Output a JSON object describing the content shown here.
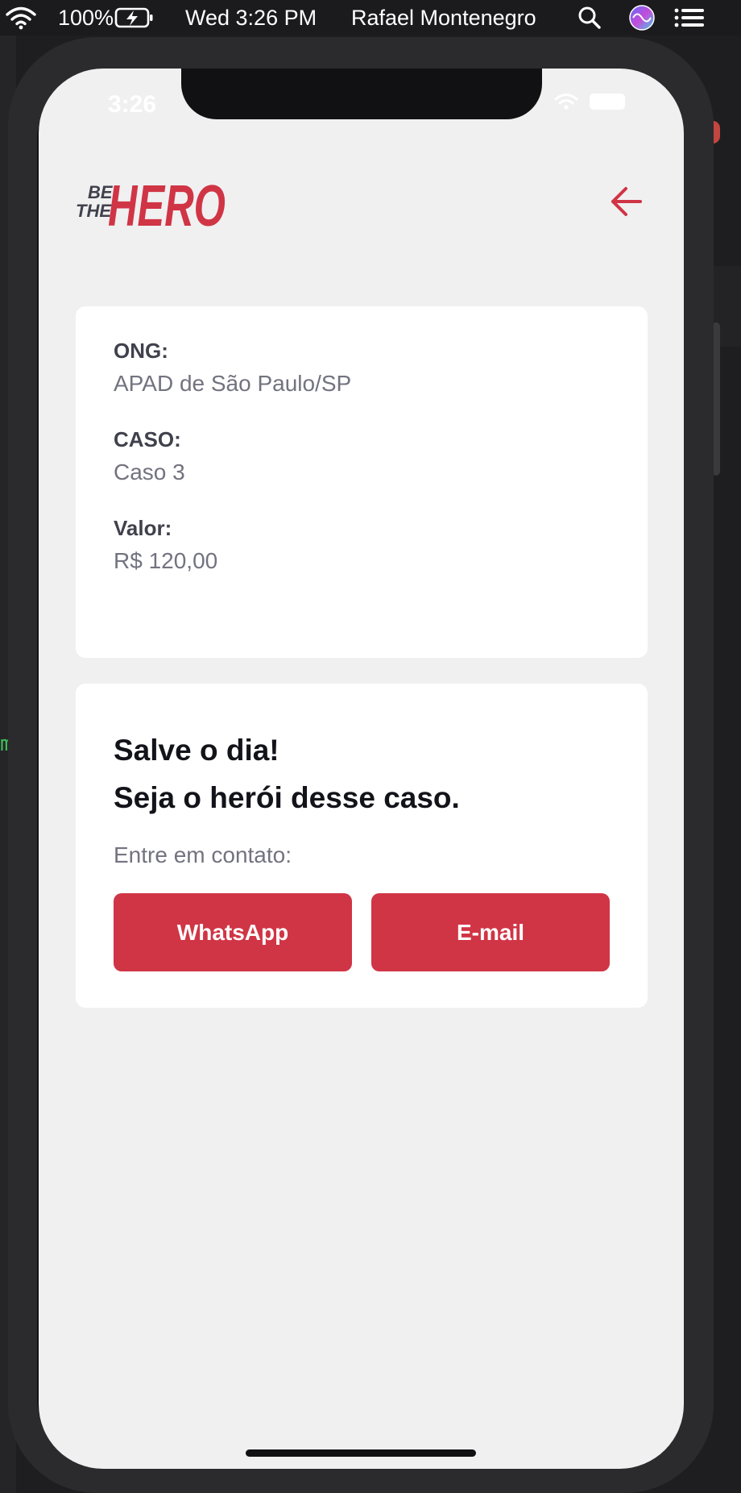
{
  "menubar": {
    "battery_percent": "100%",
    "datetime": "Wed 3:26 PM",
    "user": "Rafael Montenegro",
    "icons": [
      "wifi-icon",
      "battery-charging-icon",
      "search-icon",
      "siri-icon",
      "control-center-icon"
    ]
  },
  "ios_status": {
    "time": "3:26"
  },
  "app": {
    "logo": {
      "line1": "BE",
      "line2": "THE",
      "word": "HERO"
    },
    "back_icon": "arrow-left-icon",
    "incident": {
      "ong_label": "ONG:",
      "ong_value": "APAD de São Paulo/SP",
      "case_label": "CASO:",
      "case_value": "Caso 3",
      "value_label": "Valor:",
      "value_value": "R$ 120,00"
    },
    "contact": {
      "title_line1": "Salve o dia!",
      "title_line2": "Seja o herói desse caso.",
      "description": "Entre em contato:",
      "whatsapp_label": "WhatsApp",
      "email_label": "E-mail"
    }
  },
  "colors": {
    "accent": "#d03545",
    "screen_bg": "#f0f0f1",
    "card_bg": "#ffffff",
    "label_text": "#41414d",
    "value_text": "#737380",
    "title_text": "#13131a"
  }
}
